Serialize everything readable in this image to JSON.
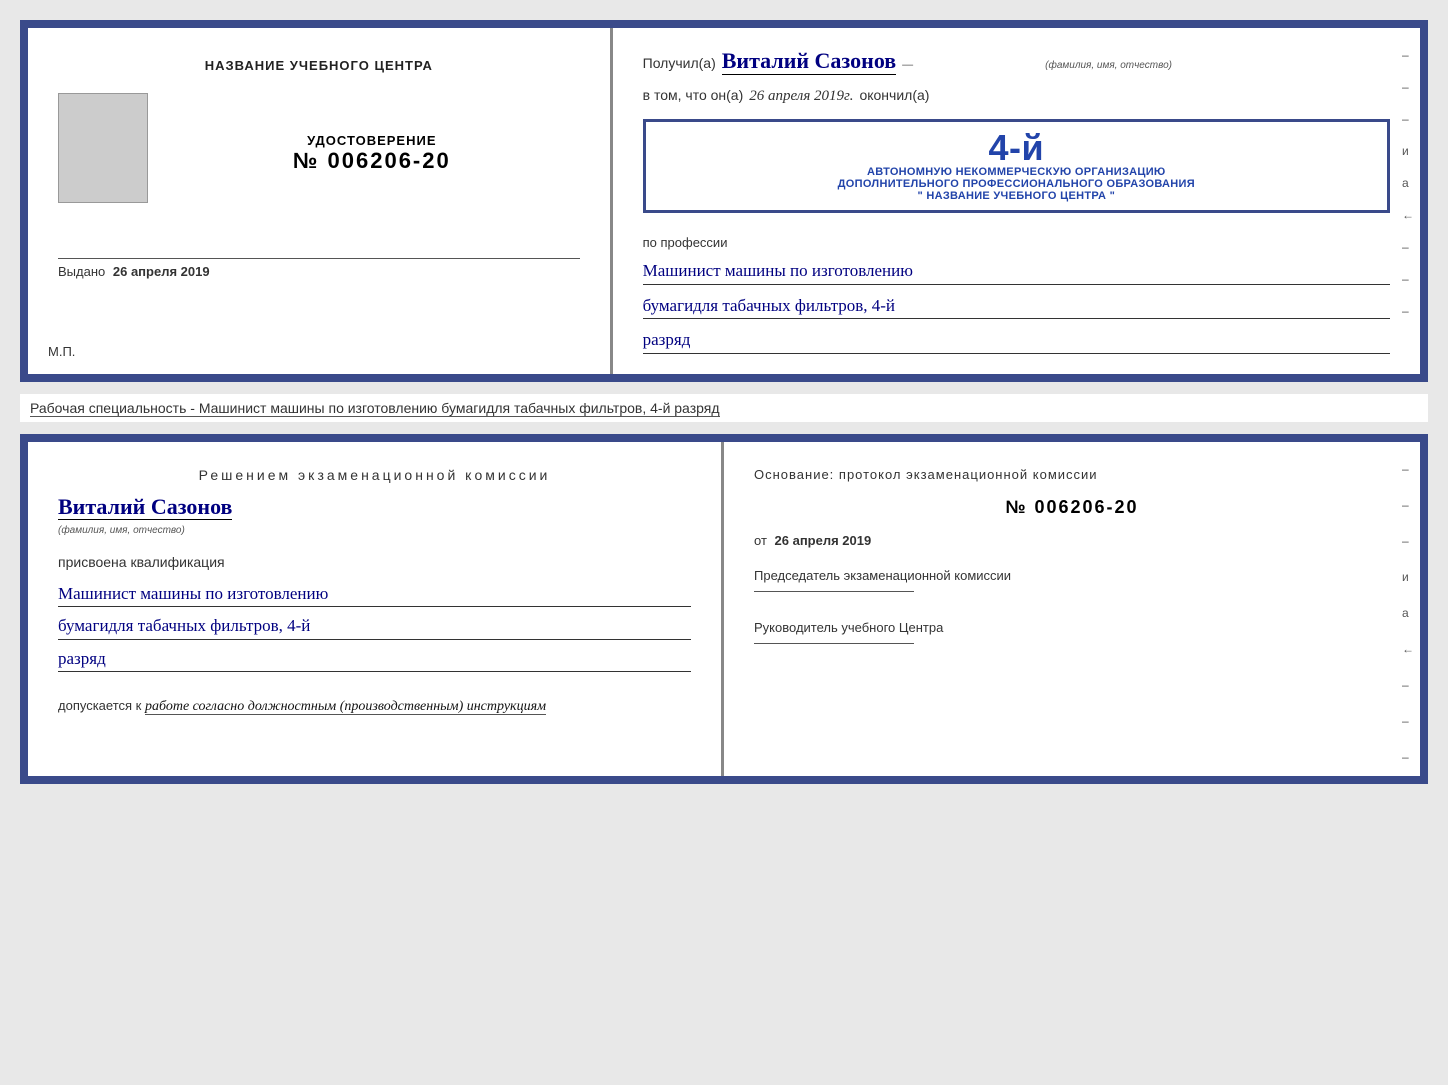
{
  "document": {
    "top_cert": {
      "left": {
        "training_center_label": "НАЗВАНИЕ УЧЕБНОГО ЦЕНТРА",
        "udostoverenie_label": "УДОСТОВЕРЕНИЕ",
        "number": "№ 006206-20",
        "vydano_label": "Выдано",
        "vydano_date": "26 апреля 2019",
        "mp_label": "М.П."
      },
      "right": {
        "poluchil_prefix": "Получил(а)",
        "recipient_name": "Виталий Сазонов",
        "fio_label": "(фамилия, имя, отчество)",
        "vtom_prefix": "в том, что он(а)",
        "date_value": "26 апреля 2019г.",
        "okonchil_label": "окончил(а)",
        "stamp_num": "4-й",
        "stamp_line1": "АВТОНОМНУЮ НЕКОММЕРЧЕСКУЮ ОРГАНИЗАЦИЮ",
        "stamp_line2": "ДОПОЛНИТЕЛЬНОГО ПРОФЕССИОНАЛЬНОГО ОБРАЗОВАНИЯ",
        "stamp_line3": "\" НАЗВАНИЕ УЧЕБНОГО ЦЕНТРА \"",
        "po_professii": "по профессии",
        "profession_line1": "Машинист машины по изготовлению",
        "profession_line2": "бумагидля табачных фильтров, 4-й",
        "profession_line3": "разряд",
        "side_marks": [
          "-",
          "-",
          "-",
          "и",
          "а",
          "←",
          "-",
          "-",
          "-",
          "-",
          "-"
        ]
      }
    },
    "middle_text": "Рабочая специальность - Машинист машины по изготовлению бумагидля табачных фильтров, 4-й разряд",
    "bottom_cert": {
      "left": {
        "decision_title": "Решением экзаменационной комиссии",
        "person_name": "Виталий Сазонов",
        "fio_label": "(фамилия, имя, отчество)",
        "prisvoena_label": "присвоена квалификация",
        "qualification_line1": "Машинист машины по изготовлению",
        "qualification_line2": "бумагидля табачных фильтров, 4-й",
        "qualification_line3": "разряд",
        "dopusk_prefix": "допускается к",
        "dopusk_text": "работе согласно должностным (производственным) инструкциям"
      },
      "right": {
        "osnov_label": "Основание: протокол экзаменационной комиссии",
        "protocol_number": "№ 006206-20",
        "ot_prefix": "от",
        "ot_date": "26 апреля 2019",
        "chairman_label": "Председатель экзаменационной комиссии",
        "chief_label": "Руководитель учебного Центра",
        "side_marks": [
          "-",
          "-",
          "-",
          "и",
          "а",
          "←",
          "-",
          "-",
          "-",
          "-",
          "-"
        ]
      }
    }
  }
}
